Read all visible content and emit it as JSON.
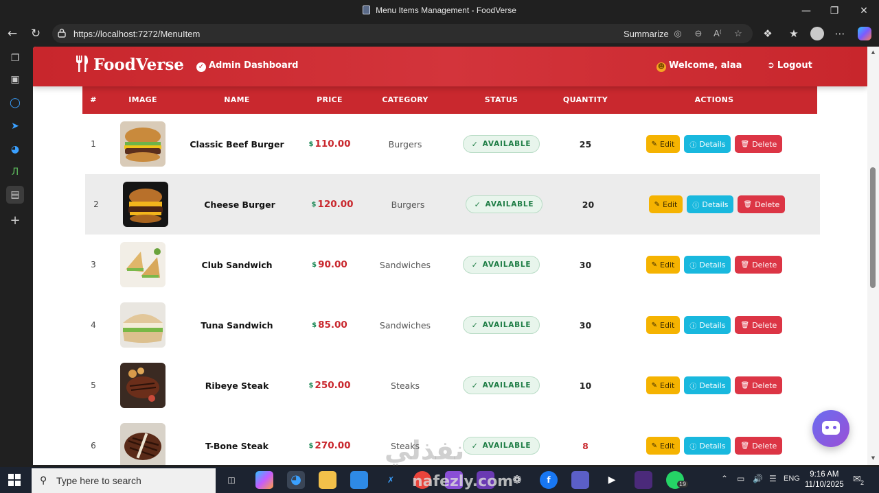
{
  "window": {
    "title": "Menu Items Management - FoodVerse"
  },
  "browser": {
    "url": "https://localhost:7272/MenuItem",
    "summarize_label": "Summarize"
  },
  "navbar": {
    "brand": "FoodVerse",
    "dashboard_label": "Admin Dashboard",
    "welcome_label": "Welcome, alaa",
    "logout_label": "Logout"
  },
  "table": {
    "columns": [
      "#",
      "IMAGE",
      "NAME",
      "PRICE",
      "CATEGORY",
      "STATUS",
      "QUANTITY",
      "ACTIONS"
    ],
    "currency_symbol": "$",
    "status_label": "AVAILABLE",
    "actions": {
      "edit": "Edit",
      "details": "Details",
      "delete": "Delete"
    },
    "rows": [
      {
        "id": "1",
        "name": "Classic Beef Burger",
        "price": "110.00",
        "category": "Burgers",
        "status": "AVAILABLE",
        "quantity": "25"
      },
      {
        "id": "2",
        "name": "Cheese Burger",
        "price": "120.00",
        "category": "Burgers",
        "status": "AVAILABLE",
        "quantity": "20"
      },
      {
        "id": "3",
        "name": "Club Sandwich",
        "price": "90.00",
        "category": "Sandwiches",
        "status": "AVAILABLE",
        "quantity": "30"
      },
      {
        "id": "4",
        "name": "Tuna Sandwich",
        "price": "85.00",
        "category": "Sandwiches",
        "status": "AVAILABLE",
        "quantity": "30"
      },
      {
        "id": "5",
        "name": "Ribeye Steak",
        "price": "250.00",
        "category": "Steaks",
        "status": "AVAILABLE",
        "quantity": "10"
      },
      {
        "id": "6",
        "name": "T-Bone Steak",
        "price": "270.00",
        "category": "Steaks",
        "status": "AVAILABLE",
        "quantity": "8"
      }
    ]
  },
  "taskbar": {
    "search_placeholder": "Type here to search",
    "time": "9:16 AM",
    "date": "11/10/2025",
    "language": "ENG",
    "whatsapp_badge": "19",
    "notification_count": "2"
  },
  "watermark": {
    "text_ar": "نفذلي",
    "text_en": "nafezly.com"
  },
  "colors": {
    "primary_red": "#c9282e",
    "success_green": "#198754",
    "edit_yellow": "#f5b301",
    "details_cyan": "#19b8de",
    "delete_red": "#dc3545"
  }
}
